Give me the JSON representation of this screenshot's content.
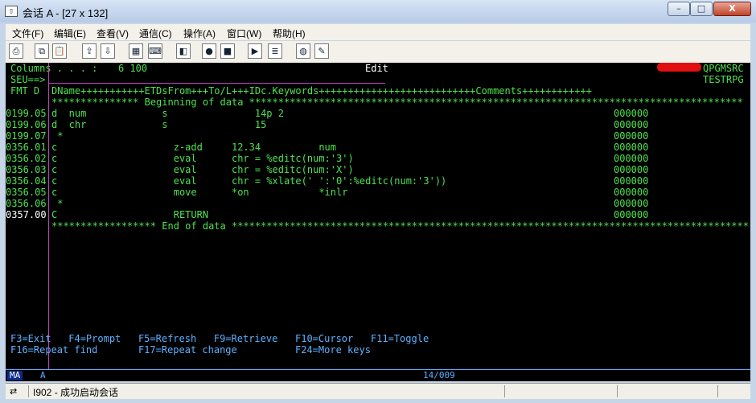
{
  "window": {
    "title": "会话 A - [27 x 132]",
    "icon": "terminal-session-icon",
    "minimize": "–",
    "maximize": "□",
    "close": "X"
  },
  "menu": [
    "文件(F)",
    "编辑(E)",
    "查看(V)",
    "通信(C)",
    "操作(A)",
    "窗口(W)",
    "帮助(H)"
  ],
  "toolbar": [
    {
      "name": "print-screen-icon",
      "glyph": "⎙"
    },
    {
      "name": "copy-icon",
      "glyph": "⧉"
    },
    {
      "name": "paste-icon",
      "glyph": "📋"
    },
    {
      "name": "send-file-icon",
      "glyph": "⇪"
    },
    {
      "name": "receive-file-icon",
      "glyph": "⇩"
    },
    {
      "name": "display-keypad-icon",
      "glyph": "▦"
    },
    {
      "name": "display-keyboard-icon",
      "glyph": "⌨"
    },
    {
      "name": "color-palette-icon",
      "glyph": "◧"
    },
    {
      "name": "record-macro-icon",
      "glyph": "●"
    },
    {
      "name": "stop-macro-icon",
      "glyph": "■"
    },
    {
      "name": "play-macro-icon",
      "glyph": "▶"
    },
    {
      "name": "macro-list-icon",
      "glyph": "≣"
    },
    {
      "name": "globe-icon",
      "glyph": "◍"
    },
    {
      "name": "help-icon",
      "glyph": "✎"
    }
  ],
  "screen": {
    "columns_label": "Columns . . . :",
    "columns_value": "6 100",
    "mode": "Edit",
    "file": "QPGMSRC",
    "member": "TESTRPG",
    "seu_prompt": "SEU==>",
    "fmt": "FMT D",
    "ruler": "DName+++++++++++ETDsFrom+++To/L+++IDc.Keywords+++++++++++++++++++++++++++Comments++++++++++++",
    "beginning": "*************** Beginning of data *************************************************************************************",
    "end": "****************** End of data *****************************************************************************************",
    "lines": [
      {
        "seq": "0199.05",
        "code": "d  num             s               14p 2",
        "date": "000000"
      },
      {
        "seq": "0199.06",
        "code": "d  chr             s               15",
        "date": "000000"
      },
      {
        "seq": "0199.07",
        "code": " *",
        "date": "000000"
      },
      {
        "seq": "0356.01",
        "code": "c                    z-add     12.34          num",
        "date": "000000"
      },
      {
        "seq": "0356.02",
        "code": "c                    eval      chr = %editc(num:'3')",
        "date": "000000"
      },
      {
        "seq": "0356.03",
        "code": "c                    eval      chr = %editc(num:'X')",
        "date": "000000"
      },
      {
        "seq": "0356.04",
        "code": "c                    eval      chr = %xlate(' ':'0':%editc(num:'3'))",
        "date": "000000"
      },
      {
        "seq": "0356.05",
        "code": "c                    move      *on            *inlr",
        "date": "000000"
      },
      {
        "seq": "0356.06",
        "code": " *",
        "date": "000000"
      },
      {
        "seq": "0357.00",
        "code": "C                    RETURN",
        "date": "000000"
      }
    ],
    "fkeys_1": "F3=Exit   F4=Prompt   F5=Refresh   F9=Retrieve   F10=Cursor   F11=Toggle",
    "fkeys_2": "F16=Repeat find       F17=Repeat change          F24=More keys"
  },
  "oia": {
    "indicator": "MA",
    "session": "A",
    "cursor": "14/009"
  },
  "status": {
    "icon": "connection-icon",
    "message": "I902 - 成功启动会话"
  }
}
